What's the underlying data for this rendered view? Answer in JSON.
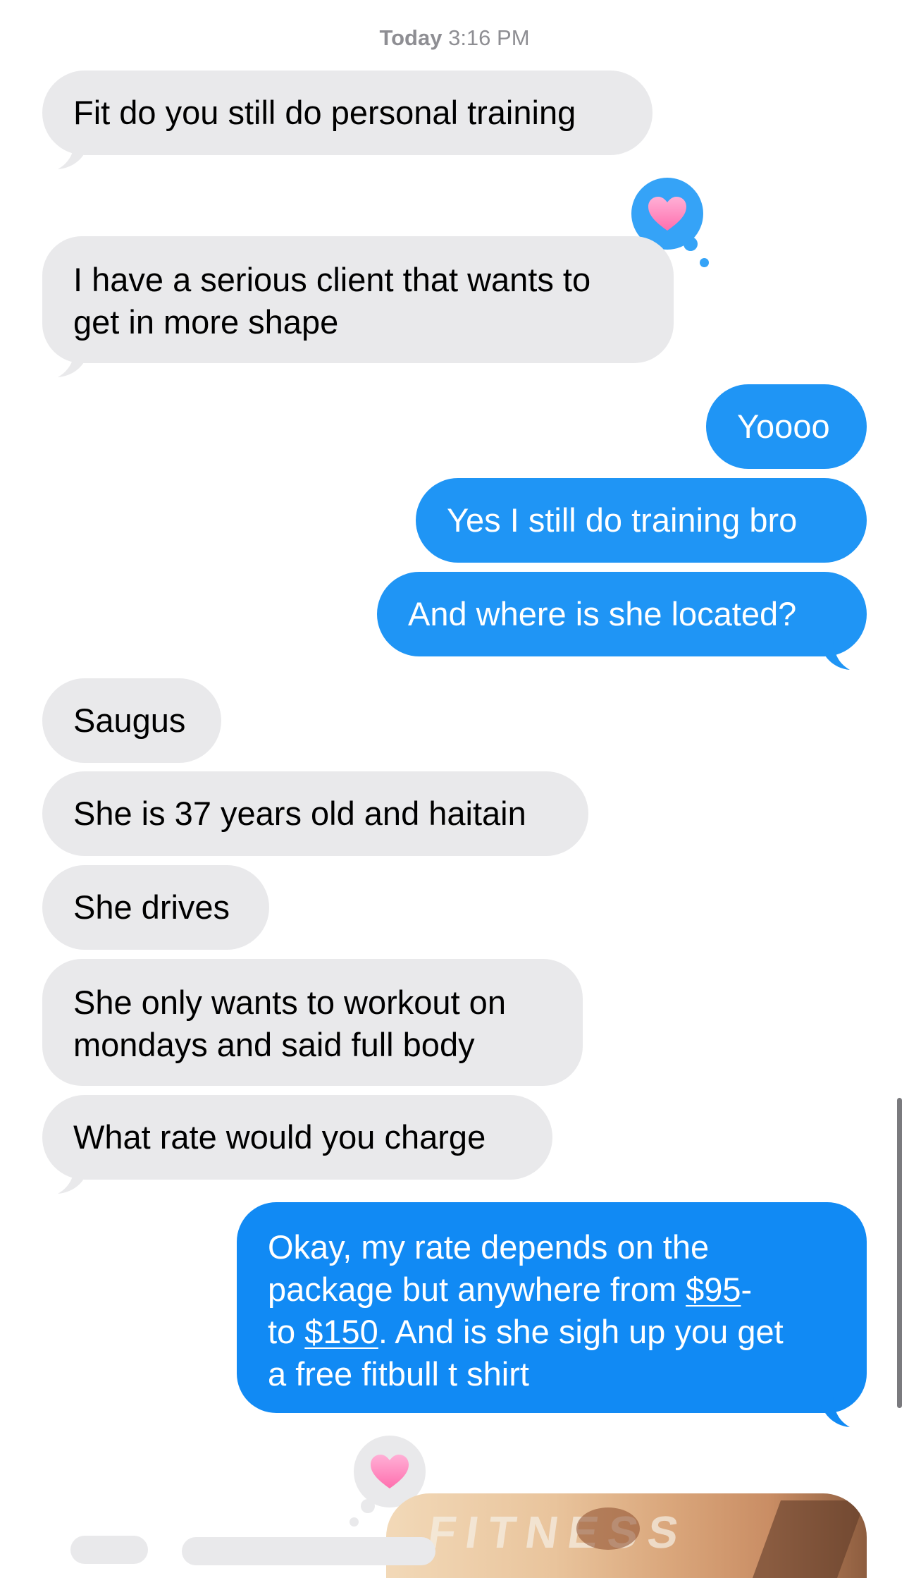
{
  "timestamp": {
    "day": "Today",
    "time": "3:16 PM"
  },
  "messages": [
    {
      "from": "them",
      "text": "Fit do you still do personal training"
    },
    {
      "from": "them",
      "lines": [
        "I have a serious client that wants to",
        "get in more shape"
      ],
      "tapback": "heart"
    },
    {
      "from": "me",
      "text": "Yoooo"
    },
    {
      "from": "me",
      "text": "Yes I still do training bro"
    },
    {
      "from": "me",
      "text": "And where is she located?"
    },
    {
      "from": "them",
      "text": "Saugus"
    },
    {
      "from": "them",
      "text": "She is 37 years old and haitain"
    },
    {
      "from": "them",
      "text": "She drives"
    },
    {
      "from": "them",
      "lines": [
        "She only wants to workout on",
        "mondays and said full body"
      ]
    },
    {
      "from": "them",
      "text": "What rate would you charge"
    },
    {
      "from": "me",
      "rich": {
        "l1": "Okay, my rate depends on the",
        "l2a": "package but anywhere from ",
        "l2_link": "$95",
        "l2b": "-",
        "l3a": "to ",
        "l3_link": "$150",
        "l3b": ". And is she sigh up you get",
        "l4": "a free fitbull t shirt"
      },
      "tapback": "heart"
    }
  ],
  "photo_text": "FITNESS",
  "colors": {
    "incoming": "#e9e9eb",
    "outgoing": "#1f95f5",
    "tapback": "#1f95f5",
    "heart": "#ff7ab8"
  }
}
